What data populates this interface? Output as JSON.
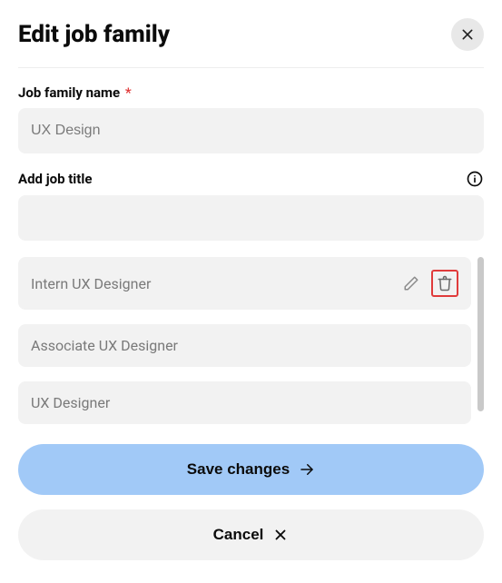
{
  "header": {
    "title": "Edit job family"
  },
  "form": {
    "name_label": "Job family name",
    "name_required_marker": "*",
    "name_value": "UX Design",
    "add_title_label": "Add job title",
    "add_title_value": ""
  },
  "job_titles": [
    {
      "label": "Intern UX Designer",
      "show_actions": true,
      "highlight_delete": true
    },
    {
      "label": "Associate UX Designer",
      "show_actions": false
    },
    {
      "label": "UX Designer",
      "show_actions": false
    }
  ],
  "footer": {
    "save_label": "Save changes",
    "cancel_label": "Cancel"
  }
}
